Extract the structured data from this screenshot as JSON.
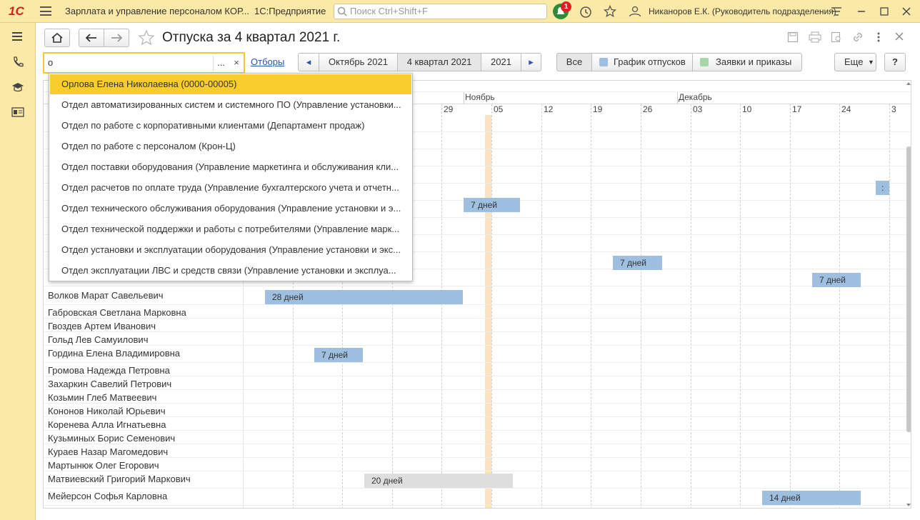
{
  "app": {
    "logo": "1С",
    "title": "Зарплата и управление персоналом КОР...",
    "platform": "1С:Предприятие",
    "search_placeholder": "Поиск Ctrl+Shift+F",
    "notification_count": "1",
    "user": "Никаноров Е.К. (Руководитель подразделения)"
  },
  "page": {
    "title": "Отпуска за 4 квартал 2021 г.",
    "filter_value": "о",
    "filter_dots": "...",
    "filter_clear": "×",
    "filters_link": "Отборы",
    "period_prev": "◂",
    "period_next": "▸",
    "periods": [
      "Октябрь 2021",
      "4 квартал 2021",
      "2021"
    ],
    "selected_period": "4 квартал 2021",
    "views": [
      "Все",
      "График отпусков",
      "Заявки и приказы"
    ],
    "view_colors": [
      "#9ebfdf",
      "#a6d5a6"
    ],
    "more_label": "Еще",
    "help_label": "?"
  },
  "dropdown": {
    "items": [
      "Орлова Елена Николаевна (0000-00005)",
      "Отдел автоматизированных систем и системного ПО (Управление установки...",
      "Отдел по работе с корпоративными клиентами (Департамент продаж)",
      "Отдел по работе с персоналом (Крон-Ц)",
      "Отдел поставки оборудования (Управление маркетинга и обслуживания кли...",
      "Отдел расчетов по оплате труда (Управление бухгалтерского учета и отчетн...",
      "Отдел технического обслуживания оборудования (Управление установки и э...",
      "Отдел технической поддержки и работы с потребителями (Управление марк...",
      "Отдел установки и эксплуатации оборудования (Управление установки и экс...",
      "Отдел эксплуатации ЛВС и средств связи (Управление установки и эксплуа..."
    ]
  },
  "calendar": {
    "months": [
      "Ноябрь",
      "Декабрь"
    ],
    "weeks": [
      "29",
      "05",
      "12",
      "19",
      "26",
      "03",
      "10",
      "17",
      "24",
      "3"
    ],
    "employees": [
      "Волков Марат Савельевич",
      "Габровская Светлана Марковна",
      "Гвоздев Артем Иванович",
      "Гольд Лев Самуилович",
      "Гордина Елена Владимировна",
      "Громова Надежда Петровна",
      "Захаркин Савелий Петрович",
      "Козьмин Глеб Матвеевич",
      "Кононов Николай Юрьевич",
      "Коренева Алла Игнатьевна",
      "Кузьминых Борис Семенович",
      "Кураев Назар Магомедович",
      "Мартынюк Олег Егорович",
      "Матвиевский Григорий Маркович",
      "Мейерсон Софья Карловна"
    ],
    "bars": [
      "7 дней",
      "7 дней",
      "7 дней",
      "28 дней",
      "7 дней",
      "20 дней",
      "14 дней",
      ":"
    ]
  }
}
